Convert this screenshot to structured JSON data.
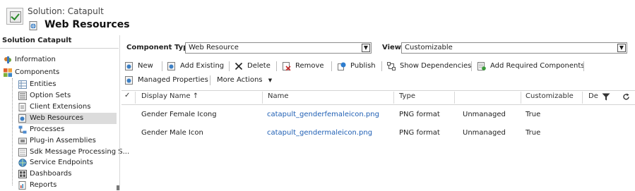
{
  "header": {
    "subtitle": "Solution: Catapult",
    "title": "Web Resources"
  },
  "sidebar": {
    "title": "Solution Catapult",
    "items": [
      {
        "label": "Information",
        "icon": "information-icon"
      },
      {
        "label": "Components",
        "icon": "components-icon"
      },
      {
        "label": "Entities",
        "icon": "entities-icon"
      },
      {
        "label": "Option Sets",
        "icon": "option-sets-icon"
      },
      {
        "label": "Client Extensions",
        "icon": "client-extensions-icon"
      },
      {
        "label": "Web Resources",
        "icon": "web-resources-icon",
        "selected": true
      },
      {
        "label": "Processes",
        "icon": "processes-icon"
      },
      {
        "label": "Plug-in Assemblies",
        "icon": "plugin-assemblies-icon"
      },
      {
        "label": "Sdk Message Processing S...",
        "icon": "sdk-message-icon"
      },
      {
        "label": "Service Endpoints",
        "icon": "service-endpoints-icon"
      },
      {
        "label": "Dashboards",
        "icon": "dashboards-icon"
      },
      {
        "label": "Reports",
        "icon": "reports-icon"
      }
    ]
  },
  "filters": {
    "component_type_label": "Component Type",
    "component_type_value": "Web Resource",
    "view_label": "View",
    "view_value": "Customizable"
  },
  "toolbar": {
    "new": "New",
    "add_existing": "Add Existing",
    "delete": "Delete",
    "remove": "Remove",
    "publish": "Publish",
    "show_dependencies": "Show Dependencies",
    "add_required": "Add Required Components",
    "managed_properties": "Managed Properties",
    "more_actions": "More Actions"
  },
  "grid": {
    "columns": {
      "display_name": "Display Name ↑",
      "name": "Name",
      "type": "Type",
      "customizable": "Customizable",
      "de": "De"
    },
    "rows": [
      {
        "display_name": "Gender Female Icong",
        "name": "catapult_genderfemaleicon.png",
        "type": "PNG format",
        "state": "Unmanaged",
        "customizable": "True"
      },
      {
        "display_name": "Gender Male Icon",
        "name": "catapult_gendermaleicon.png",
        "type": "PNG format",
        "state": "Unmanaged",
        "customizable": "True"
      }
    ]
  },
  "colors": {
    "link": "#1f5fb4",
    "selected_bg": "#dcdcdc"
  }
}
